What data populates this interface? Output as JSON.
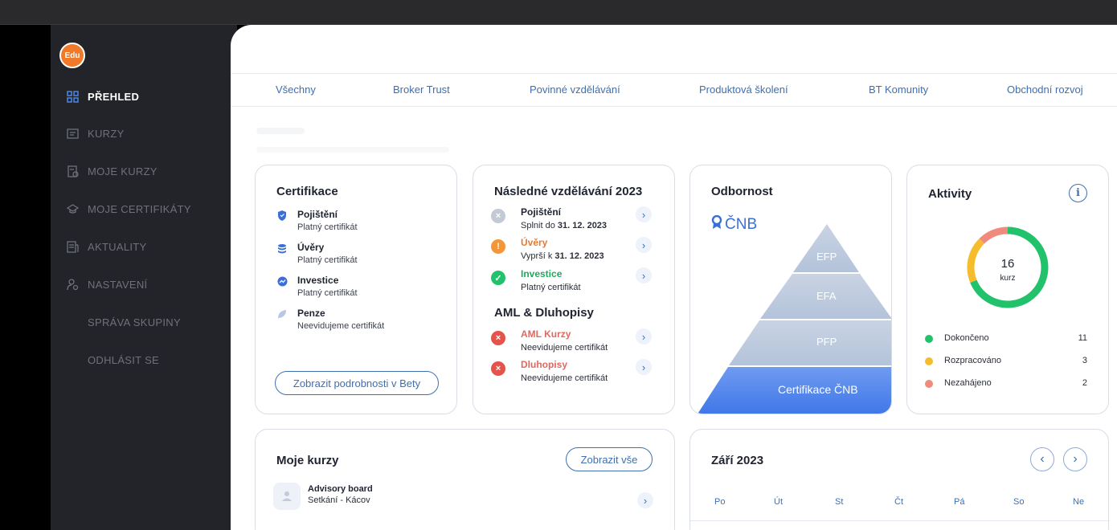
{
  "user": {
    "avatar_text": "Edu"
  },
  "sidebar": {
    "items": [
      {
        "label": "PŘEHLED",
        "icon": "grid-icon"
      },
      {
        "label": "KURZY",
        "icon": "course-icon"
      },
      {
        "label": "MOJE KURZY",
        "icon": "my-courses-icon"
      },
      {
        "label": "MOJE CERTIFIKÁTY",
        "icon": "certificate-icon"
      },
      {
        "label": "AKTUALITY",
        "icon": "news-icon"
      },
      {
        "label": "NASTAVENÍ",
        "icon": "user-settings-icon"
      },
      {
        "label": "SPRÁVA SKUPINY"
      },
      {
        "label": "ODHLÁSIT SE"
      }
    ]
  },
  "tabs": [
    "Všechny",
    "Broker Trust",
    "Povinné vzdělávání",
    "Produktová školení",
    "BT Komunity",
    "Obchodní rozvoj"
  ],
  "certifikace": {
    "title": "Certifikace",
    "items": [
      {
        "name": "Pojištění",
        "status": "Platný certifikát",
        "icon": "shield-icon"
      },
      {
        "name": "Úvěry",
        "status": "Platný certifikát",
        "icon": "coins-icon"
      },
      {
        "name": "Investice",
        "status": "Platný certifikát",
        "icon": "chart-badge-icon"
      },
      {
        "name": "Penze",
        "status": "Neevidujeme certifikát",
        "icon": "leaf-icon"
      }
    ],
    "button": "Zobrazit podrobnosti v Bety"
  },
  "nasledne": {
    "title": "Následné vzdělávání 2023",
    "items": [
      {
        "name": "Pojištění",
        "sub_prefix": "Splnit do",
        "sub_date": "31. 12. 2023",
        "state": "pending"
      },
      {
        "name": "Úvěry",
        "sub_prefix": "Vyprší k",
        "sub_date": "31. 12. 2023",
        "state": "warning"
      },
      {
        "name": "Investice",
        "sub_prefix": "Platný certifikát",
        "sub_date": "",
        "state": "ok"
      }
    ],
    "aml_title": "AML & Dluhopisy",
    "aml_items": [
      {
        "name": "AML Kurzy",
        "status": "Neevidujeme certifikát"
      },
      {
        "name": "Dluhopisy",
        "status": "Neevidujeme certifikát"
      }
    ]
  },
  "odbornost": {
    "title": "Odbornost",
    "logo": "ČNB",
    "levels": [
      "EFP",
      "EFA",
      "PFP",
      "Certifikace ČNB"
    ]
  },
  "aktivity": {
    "title": "Aktivity",
    "total": "16",
    "unit": "kurz",
    "legend": [
      {
        "label": "Dokončeno",
        "value": "11",
        "color": "#22c16b"
      },
      {
        "label": "Rozpracováno",
        "value": "3",
        "color": "#f5bd2e"
      },
      {
        "label": "Nezahájeno",
        "value": "2",
        "color": "#ef8a7c"
      }
    ]
  },
  "moje_kurzy": {
    "title": "Moje kurzy",
    "button": "Zobrazit vše",
    "items": [
      {
        "name": "Advisory board",
        "sub": "Setkání - Kácov"
      }
    ]
  },
  "kalendar": {
    "title": "Září 2023",
    "days": [
      "Po",
      "Út",
      "St",
      "Čt",
      "Pá",
      "So",
      "Ne"
    ]
  },
  "colors": {
    "accent": "#3e6fb3",
    "sidebar": "#232429",
    "success": "#22c16b",
    "warning": "#f5953a",
    "danger": "#e5534b"
  }
}
